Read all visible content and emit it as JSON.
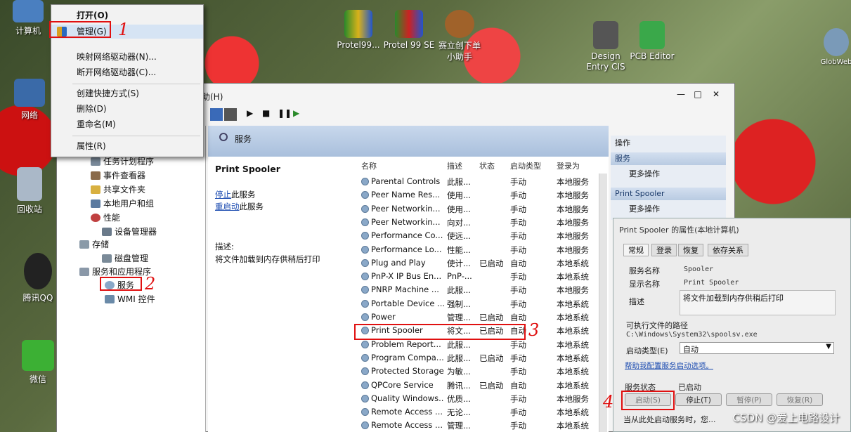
{
  "desktop": {
    "icons": [
      "计算机",
      "网络",
      "回收站",
      "腾讯QQ",
      "微信",
      "Protel99...",
      "Protel 99 SE",
      "赛立创下单\n小助手",
      "Design\nEntry CIS",
      "PCB Editor",
      "GlobWeb"
    ]
  },
  "context_menu": {
    "items": [
      "打开(O)",
      "管理(G)",
      "映射网络驱动器(N)...",
      "断开网络驱动器(C)...",
      "创建快捷方式(S)",
      "删除(D)",
      "重命名(M)",
      "属性(R)"
    ]
  },
  "annotations": {
    "n1": "1",
    "n2": "2",
    "n3": "3",
    "n4": "4"
  },
  "mmc": {
    "menu_help": "助(H)",
    "window_controls": [
      "—",
      "□",
      "✕"
    ],
    "tree": {
      "items": [
        "任务计划程序",
        "事件查看器",
        "共享文件夹",
        "本地用户和组",
        "性能",
        "设备管理器",
        "存储",
        "磁盘管理",
        "服务和应用程序",
        "服务",
        "WMI 控件"
      ]
    },
    "services_header": "服务",
    "detail": {
      "title": "Print Spooler",
      "stop_link": "停止",
      "stop_rest": "此服务",
      "restart_link": "重启动",
      "restart_rest": "此服务",
      "desc_label": "描述:",
      "desc_text": "将文件加载到内存供稍后打印"
    },
    "columns": [
      "名称",
      "描述",
      "状态",
      "启动类型",
      "登录为"
    ],
    "rows": [
      [
        "Parental Controls",
        "此服...",
        "",
        "手动",
        "本地服务"
      ],
      [
        "Peer Name Res...",
        "使用...",
        "",
        "手动",
        "本地服务"
      ],
      [
        "Peer Networkin...",
        "使用...",
        "",
        "手动",
        "本地服务"
      ],
      [
        "Peer Networkin...",
        "向对...",
        "",
        "手动",
        "本地服务"
      ],
      [
        "Performance Co...",
        "使远...",
        "",
        "手动",
        "本地服务"
      ],
      [
        "Performance Lo...",
        "性能...",
        "",
        "手动",
        "本地服务"
      ],
      [
        "Plug and Play",
        "使计...",
        "已启动",
        "自动",
        "本地系统"
      ],
      [
        "PnP-X IP Bus En...",
        "PnP-...",
        "",
        "手动",
        "本地系统"
      ],
      [
        "PNRP Machine ...",
        "此服...",
        "",
        "手动",
        "本地服务"
      ],
      [
        "Portable Device ...",
        "强制...",
        "",
        "手动",
        "本地系统"
      ],
      [
        "Power",
        "管理...",
        "已启动",
        "自动",
        "本地系统"
      ],
      [
        "Print Spooler",
        "将文...",
        "已启动",
        "自动",
        "本地系统"
      ],
      [
        "Problem Report...",
        "此服...",
        "",
        "手动",
        "本地系统"
      ],
      [
        "Program Compa...",
        "此服...",
        "已启动",
        "手动",
        "本地系统"
      ],
      [
        "Protected Storage",
        "为敏...",
        "",
        "手动",
        "本地系统"
      ],
      [
        "QPCore Service",
        "腾讯...",
        "已启动",
        "自动",
        "本地系统"
      ],
      [
        "Quality Windows...",
        "优质...",
        "",
        "手动",
        "本地服务"
      ],
      [
        "Remote Access ...",
        "无论...",
        "",
        "手动",
        "本地系统"
      ],
      [
        "Remote Access ...",
        "管理...",
        "",
        "手动",
        "本地系统"
      ]
    ],
    "actions": {
      "header1": "操作",
      "section1": "服务",
      "more1": "更多操作",
      "section2": "Print Spooler",
      "more2": "更多操作"
    }
  },
  "dialog": {
    "title": "Print Spooler 的属性(本地计算机)",
    "tabs": [
      "常规",
      "登录",
      "恢复",
      "依存关系"
    ],
    "service_name_label": "服务名称",
    "service_name": "Spooler",
    "display_name_label": "显示名称",
    "display_name": "Print Spooler",
    "desc_label": "描述",
    "desc": "将文件加载到内存供稍后打印",
    "exe_label": "可执行文件的路径",
    "exe_path": "C:\\Windows\\System32\\spoolsv.exe",
    "startup_label": "启动类型(E)",
    "startup_value": "自动",
    "help_link": "帮助我配置服务启动选项。",
    "status_label": "服务状态",
    "status_value": "已启动",
    "btn_start": "启动(S)",
    "btn_stop": "停止(T)",
    "btn_pause": "暂停(P)",
    "btn_resume": "恢复(R)",
    "footer": "当从此处启动服务时，您..."
  },
  "watermark": "CSDN @爱上电路设计"
}
